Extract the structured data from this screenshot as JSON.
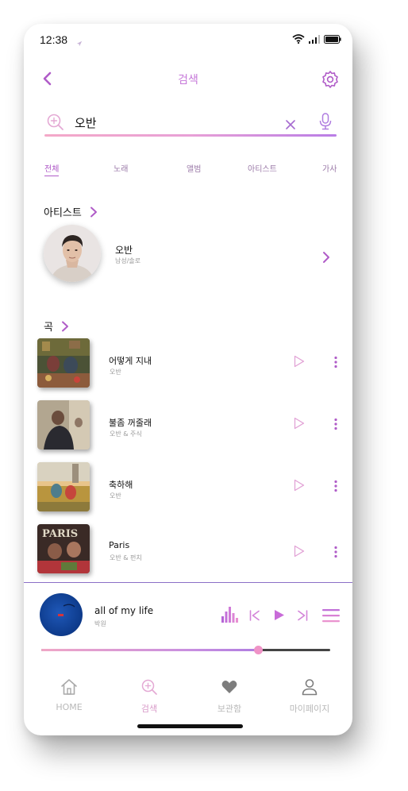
{
  "status": {
    "time": "12:38"
  },
  "header": {
    "title": "검색"
  },
  "search": {
    "query": "오반"
  },
  "tabs": [
    {
      "label": "전체",
      "active": true
    },
    {
      "label": "노래"
    },
    {
      "label": "앨범"
    },
    {
      "label": "아티스트"
    },
    {
      "label": "가사"
    }
  ],
  "artist_section": {
    "title": "아티스트",
    "artist": {
      "name": "오반",
      "sub": "남성/솔로"
    }
  },
  "song_section": {
    "title": "곡",
    "songs": [
      {
        "title": "어떻게 지내",
        "artist": "오반"
      },
      {
        "title": "불좀 꺼줄래",
        "artist": "오반 & 주식"
      },
      {
        "title": "축하해",
        "artist": "오반"
      },
      {
        "title": "Paris",
        "artist": "오반 & 펀치"
      }
    ]
  },
  "now_playing": {
    "title": "all of my life",
    "artist": "박원",
    "progress": 0.75
  },
  "bottom_nav": [
    {
      "label": "HOME",
      "icon": "home-icon"
    },
    {
      "label": "검색",
      "icon": "search-icon",
      "active": true
    },
    {
      "label": "보관함",
      "icon": "heart-icon"
    },
    {
      "label": "마이페이지",
      "icon": "user-icon"
    }
  ],
  "colors": {
    "accent": "#b05cc8",
    "accent_light": "#c678d9",
    "pink": "#f4a9c8"
  }
}
